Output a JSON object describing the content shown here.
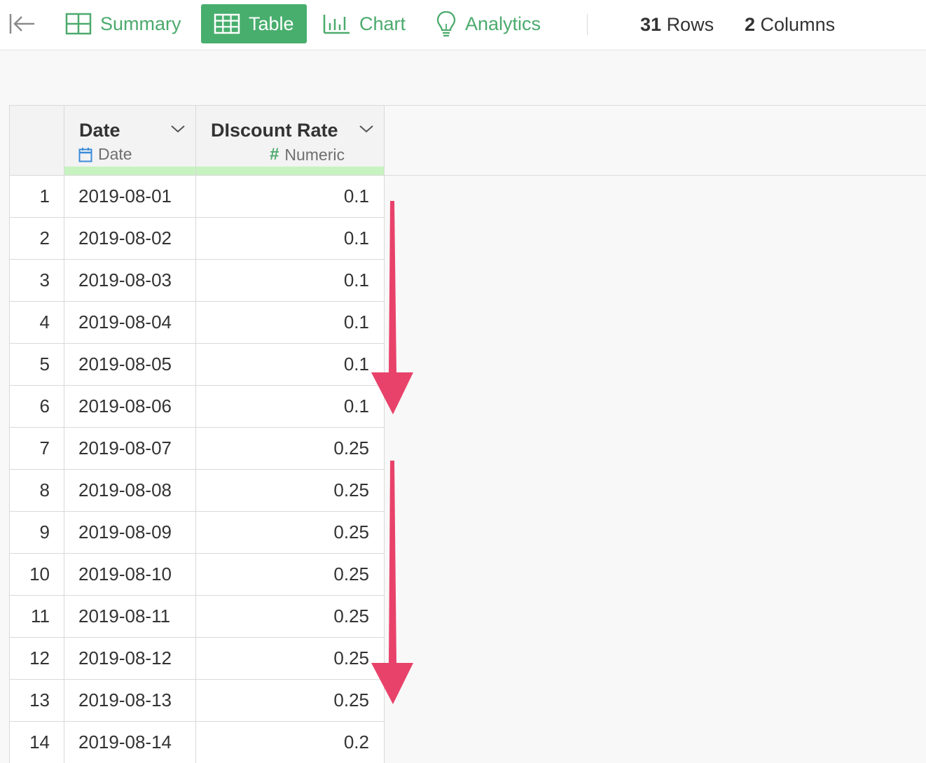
{
  "toolbar": {
    "tabs": [
      {
        "label": "Summary",
        "icon": "summary-grid-icon",
        "active": false
      },
      {
        "label": "Table",
        "icon": "table-icon",
        "active": true
      },
      {
        "label": "Chart",
        "icon": "bar-chart-icon",
        "active": false
      },
      {
        "label": "Analytics",
        "icon": "lightbulb-icon",
        "active": false
      }
    ],
    "rows_count": "31",
    "rows_label": "Rows",
    "columns_count": "2",
    "columns_label": "Columns"
  },
  "colors": {
    "accent": "#48ae6d",
    "accent_text": "#4caa6d",
    "quality_bar": "#c7f3c0",
    "annotation_arrow": "#e8426a",
    "date_icon": "#3b8bd9"
  },
  "table": {
    "columns": [
      {
        "name": "Date",
        "type": "Date",
        "type_icon": "calendar-icon"
      },
      {
        "name": "DIscount Rate",
        "type": "Numeric",
        "type_icon": "hash-icon"
      }
    ],
    "rows": [
      {
        "index": "1",
        "date": "2019-08-01",
        "rate": "0.1"
      },
      {
        "index": "2",
        "date": "2019-08-02",
        "rate": "0.1"
      },
      {
        "index": "3",
        "date": "2019-08-03",
        "rate": "0.1"
      },
      {
        "index": "4",
        "date": "2019-08-04",
        "rate": "0.1"
      },
      {
        "index": "5",
        "date": "2019-08-05",
        "rate": "0.1"
      },
      {
        "index": "6",
        "date": "2019-08-06",
        "rate": "0.1"
      },
      {
        "index": "7",
        "date": "2019-08-07",
        "rate": "0.25"
      },
      {
        "index": "8",
        "date": "2019-08-08",
        "rate": "0.25"
      },
      {
        "index": "9",
        "date": "2019-08-09",
        "rate": "0.25"
      },
      {
        "index": "10",
        "date": "2019-08-10",
        "rate": "0.25"
      },
      {
        "index": "11",
        "date": "2019-08-11",
        "rate": "0.25"
      },
      {
        "index": "12",
        "date": "2019-08-12",
        "rate": "0.25"
      },
      {
        "index": "13",
        "date": "2019-08-13",
        "rate": "0.25"
      },
      {
        "index": "14",
        "date": "2019-08-14",
        "rate": "0.2"
      }
    ]
  }
}
